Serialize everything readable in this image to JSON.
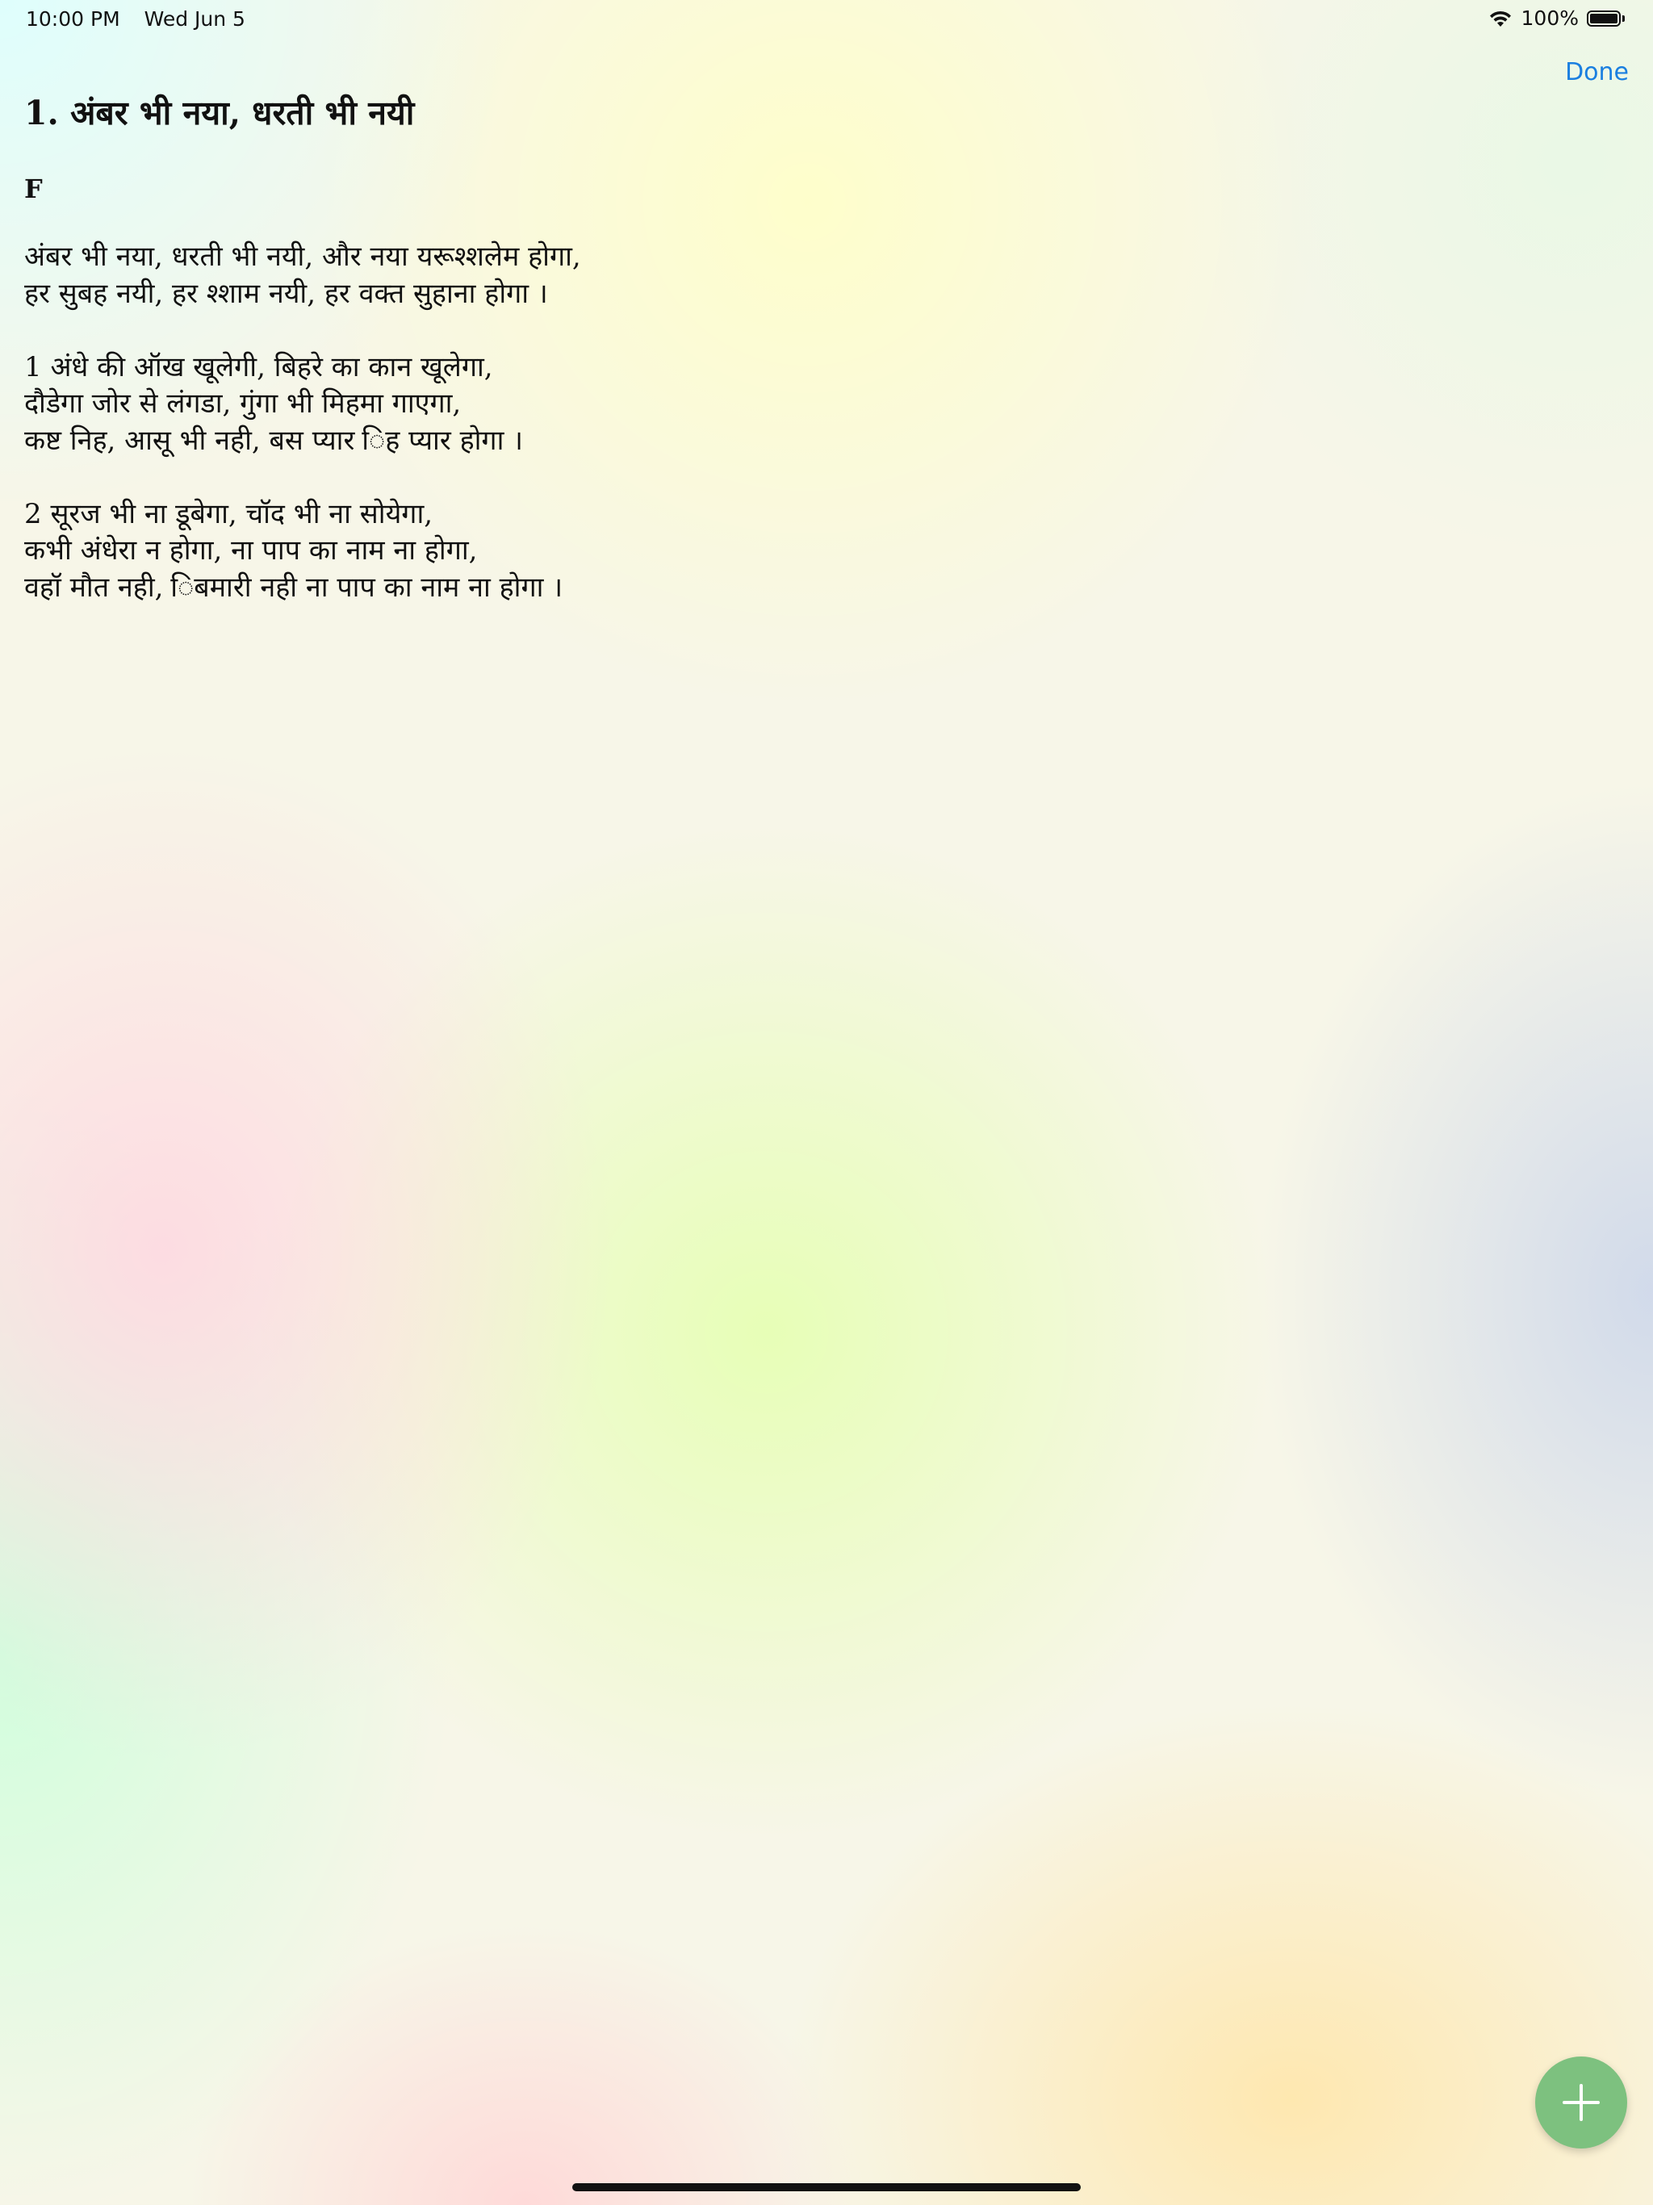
{
  "status_bar": {
    "time": "10:00 PM",
    "date": "Wed Jun 5",
    "battery": "100%",
    "wifi_icon": "wifi-icon",
    "battery_icon": "battery-icon"
  },
  "nav": {
    "done_label": "Done"
  },
  "song": {
    "title": "1. अंबर भी नया, धरती भी नयी",
    "key": "F",
    "stanzas": [
      {
        "lines": [
          "अंबर भी नया, धरती भी नयी, और नया यरूश्शलेम होगा,",
          "हर सुबह नयी, हर श्शाम नयी, हर वक्त सुहाना होगा ।"
        ]
      },
      {
        "lines": [
          "1 अंधे की ऑख खूलेगी, बिहरे का कान खूलेगा,",
          "दौडेगा जोर से लंगडा, गुंगा भी मिहमा गाएगा,",
          "कष्ट निह, आसू भी नही, बस प्यार िह प्यार होगा ।"
        ]
      },
      {
        "lines": [
          "2 सूरज भी ना डूबेगा, चॉद भी ना सोयेगा,",
          "कभी अंधेरा न होगा, ना पाप का नाम ना होगा,",
          "वहॉ मौत नही, िबमारी नही ना पाप का नाम ना होगा ।"
        ]
      }
    ]
  },
  "fab": {
    "icon": "plus-icon",
    "color": "#7dc17f"
  },
  "colors": {
    "accent": "#1a7fe0"
  }
}
